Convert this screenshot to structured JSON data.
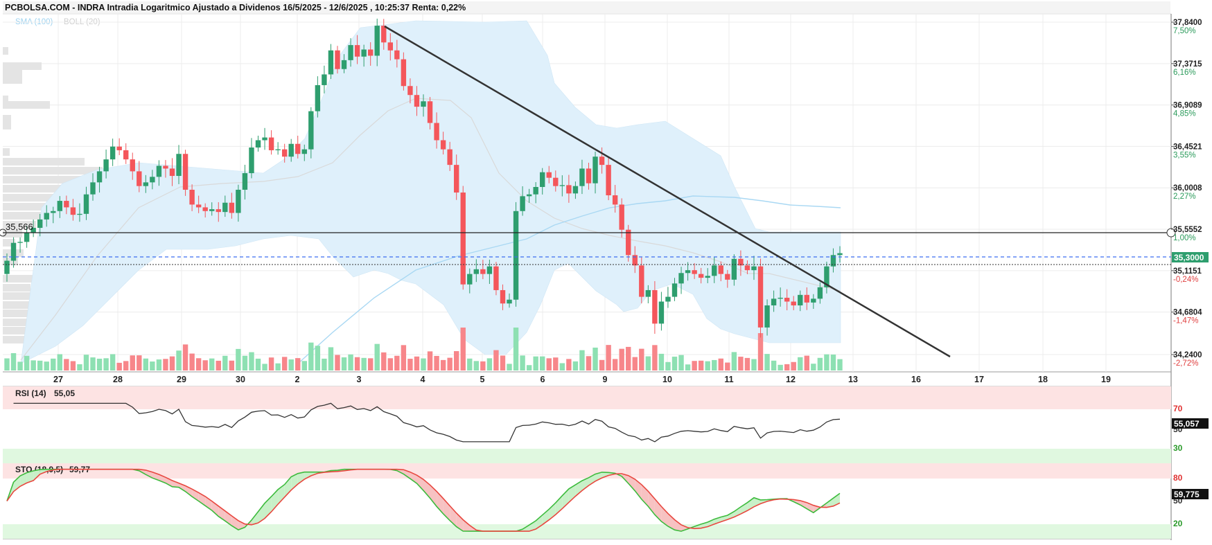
{
  "header": {
    "title": "PCBOLSA.COM - INDRA Intradia Logaritmico Ajustado a Dividenos 16/5/2025 - 12/6/2025 , 10:25:37 Renta: 0,22%"
  },
  "legend": {
    "sma": "SMA (100)",
    "boll": "BOLL (20)"
  },
  "colors": {
    "up": "#2e9e6e",
    "down": "#f4565b",
    "vol_up": "#8de0b2",
    "vol_down": "#f7868a",
    "band_fill": "#dff0fb",
    "sma": "#a9d8f3",
    "boll_mid": "#d9d9d9",
    "trendline": "#333333",
    "price_box": "#2e9e6e",
    "stoch_k": "#3dbb3d",
    "stoch_d": "#e8473f"
  },
  "price_axis": {
    "ticks": [
      {
        "price": "37,8400",
        "pct": "7,50%",
        "pos": true
      },
      {
        "price": "37,3715",
        "pct": "6,16%",
        "pos": true
      },
      {
        "price": "36,9089",
        "pct": "4,85%",
        "pos": true
      },
      {
        "price": "36,4521",
        "pct": "3,55%",
        "pos": true
      },
      {
        "price": "36,0008",
        "pct": "2,27%",
        "pos": true
      },
      {
        "price": "35,5552",
        "pct": "1,00%",
        "pos": true
      },
      {
        "price": "35,1151",
        "pct": "-0,24%",
        "pos": false
      },
      {
        "price": "34,6804",
        "pct": "-1,47%",
        "pos": false
      },
      {
        "price": "34,2400",
        "pct": "-2,72%",
        "pos": false
      }
    ],
    "current_price": "35,3000",
    "level_label": "35,566"
  },
  "x_axis": {
    "labels": [
      "27",
      "28",
      "29",
      "30",
      "2",
      "3",
      "4",
      "5",
      "6",
      "9",
      "10",
      "11",
      "12",
      "13",
      "16",
      "17",
      "18",
      "19"
    ]
  },
  "rsi": {
    "label": "RSI (14)",
    "value": "55,05",
    "box": "55,057",
    "level_high": "70",
    "level_mid": "50",
    "level_low": "30"
  },
  "stoch": {
    "label": "STO (18,9,5)",
    "value": "59,77",
    "box": "59,775",
    "level_high": "80",
    "level_mid": "50",
    "level_low": "20"
  },
  "chart_data": {
    "type": "candlestick",
    "title": "PCBOLSA.COM - INDRA Intradia Logaritmico Ajustado a Dividenos 16/5/2025 - 12/6/2025 , 10:25:37 Renta: 0,22%",
    "y_scale": "log",
    "y_range": [
      34.24,
      37.84
    ],
    "x_categories": [
      "27",
      "28",
      "29",
      "30",
      "2",
      "3",
      "4",
      "5",
      "6",
      "9",
      "10",
      "11",
      "12",
      "13",
      "16",
      "17",
      "18",
      "19"
    ],
    "indicators": [
      "SMA (100)",
      "BOLL (20)"
    ],
    "closes": [
      35.22,
      35.41,
      35.42,
      35.52,
      35.57,
      35.66,
      35.73,
      35.75,
      35.86,
      35.79,
      35.71,
      35.72,
      35.93,
      36.06,
      36.18,
      36.31,
      36.45,
      36.41,
      36.31,
      36.18,
      36.02,
      36.06,
      36.12,
      36.24,
      36.21,
      36.13,
      36.37,
      35.98,
      35.82,
      35.79,
      35.75,
      35.77,
      35.74,
      35.84,
      35.73,
      35.98,
      36.16,
      36.44,
      36.52,
      36.55,
      36.41,
      36.42,
      36.34,
      36.48,
      36.37,
      36.42,
      36.84,
      37.13,
      37.25,
      37.52,
      37.31,
      37.41,
      37.58,
      37.45,
      37.53,
      37.46,
      37.8,
      37.61,
      37.52,
      37.42,
      37.12,
      37.02,
      36.89,
      36.95,
      36.71,
      36.52,
      36.42,
      36.25,
      35.95,
      34.97,
      35.08,
      35.13,
      35.08,
      35.16,
      34.91,
      34.77,
      34.81,
      35.75,
      35.91,
      35.93,
      36.01,
      36.17,
      36.11,
      36.02,
      36.03,
      35.94,
      36.02,
      36.21,
      36.05,
      36.34,
      36.25,
      35.92,
      35.82,
      35.55,
      35.28,
      35.17,
      34.84,
      34.91,
      34.56,
      34.79,
      34.84,
      34.98,
      35.09,
      35.12,
      35.08,
      35.04,
      35.06,
      35.17,
      35.08,
      35.02,
      35.24,
      35.17,
      35.12,
      35.16,
      34.52,
      34.75,
      34.82,
      34.83,
      34.79,
      34.75,
      34.86,
      34.78,
      34.82,
      34.94,
      35.16,
      35.28,
      35.3
    ],
    "rsi_range": [
      0,
      100
    ],
    "stoch_range": [
      0,
      100
    ],
    "rsi_last": 55.05,
    "stoch_last": 59.77
  }
}
